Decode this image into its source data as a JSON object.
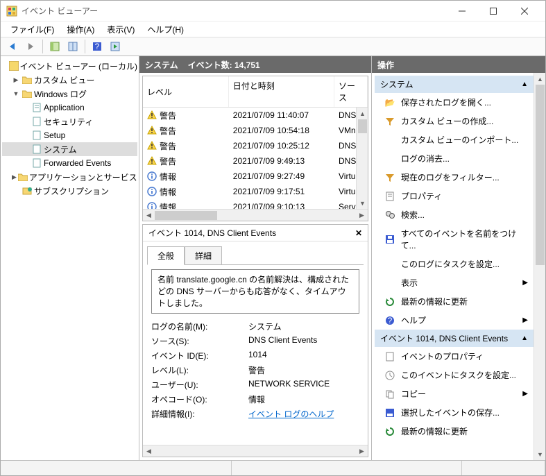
{
  "window": {
    "title": "イベント ビューアー"
  },
  "menus": {
    "file": "ファイル(F)",
    "action": "操作(A)",
    "view": "表示(V)",
    "help": "ヘルプ(H)"
  },
  "tree": {
    "root": "イベント ビューアー (ローカル)",
    "custom_views": "カスタム ビュー",
    "windows_logs": "Windows ログ",
    "application": "Application",
    "security": "セキュリティ",
    "setup": "Setup",
    "system": "システム",
    "forwarded": "Forwarded Events",
    "app_services": "アプリケーションとサービス ログ",
    "subscriptions": "サブスクリプション"
  },
  "center": {
    "title": "システム",
    "count_label": "イベント数: 14,751",
    "columns": {
      "level": "レベル",
      "date": "日付と時刻",
      "source": "ソース"
    },
    "rows": [
      {
        "level": "警告",
        "level_kind": "warn",
        "date": "2021/07/09 11:40:07",
        "source": "DNS "
      },
      {
        "level": "警告",
        "level_kind": "warn",
        "date": "2021/07/09 10:54:18",
        "source": "VMn"
      },
      {
        "level": "警告",
        "level_kind": "warn",
        "date": "2021/07/09 10:25:12",
        "source": "DNS "
      },
      {
        "level": "警告",
        "level_kind": "warn",
        "date": "2021/07/09 9:49:13",
        "source": "DNS "
      },
      {
        "level": "情報",
        "level_kind": "info",
        "date": "2021/07/09 9:27:49",
        "source": "Virtu"
      },
      {
        "level": "情報",
        "level_kind": "info",
        "date": "2021/07/09 9:17:51",
        "source": "Virtu"
      },
      {
        "level": "情報",
        "level_kind": "info",
        "date": "2021/07/09 9:10:13",
        "source": "Servi"
      }
    ]
  },
  "detail": {
    "title": "イベント 1014, DNS Client Events",
    "tab_general": "全般",
    "tab_detail": "詳細",
    "message": "名前 translate.google.cn の名前解決は、構成されたどの DNS サーバーからも応答がなく、タイムアウトしました。",
    "props": {
      "log_name_label": "ログの名前(M):",
      "log_name_value": "システム",
      "source_label": "ソース(S):",
      "source_value": "DNS Client Events",
      "event_id_label": "イベント ID(E):",
      "event_id_value": "1014",
      "level_label": "レベル(L):",
      "level_value": "警告",
      "user_label": "ユーザー(U):",
      "user_value": "NETWORK SERVICE",
      "opcode_label": "オペコード(O):",
      "opcode_value": "情報",
      "moreinfo_label": "詳細情報(I):",
      "moreinfo_link": "イベント ログのヘルプ"
    }
  },
  "actions": {
    "header": "操作",
    "section1": "システム",
    "open_saved": "保存されたログを開く...",
    "create_view": "カスタム ビューの作成...",
    "import_view": "カスタム ビューのインポート...",
    "clear_log": "ログの消去...",
    "filter": "現在のログをフィルター...",
    "properties": "プロパティ",
    "find": "検索...",
    "save_all": "すべてのイベントを名前をつけて...",
    "attach_task": "このログにタスクを設定...",
    "view": "表示",
    "refresh": "最新の情報に更新",
    "help": "ヘルプ",
    "section2": "イベント 1014, DNS Client Events",
    "event_props": "イベントのプロパティ",
    "event_task": "このイベントにタスクを設定...",
    "copy": "コピー",
    "save_selected": "選択したイベントの保存...",
    "refresh2": "最新の情報に更新"
  }
}
